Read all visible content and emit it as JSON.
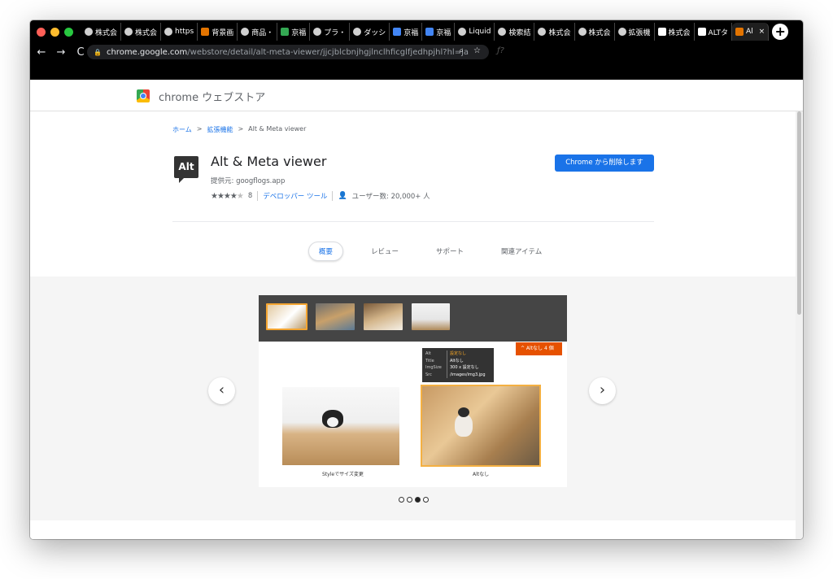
{
  "browser": {
    "tabs": [
      {
        "label": "株式会",
        "icon": "globe-icon"
      },
      {
        "label": "株式会",
        "icon": "globe-icon"
      },
      {
        "label": "https",
        "icon": "globe-icon"
      },
      {
        "label": "背景画",
        "icon": "image-icon"
      },
      {
        "label": "商品・",
        "icon": "globe-icon"
      },
      {
        "label": "京福",
        "icon": "sheets-icon"
      },
      {
        "label": "プラ・",
        "icon": "layers-icon"
      },
      {
        "label": "ダッシ",
        "icon": "globe-icon"
      },
      {
        "label": "京福",
        "icon": "docs-icon"
      },
      {
        "label": "京福",
        "icon": "docs-icon"
      },
      {
        "label": "Liquid",
        "icon": "drop-icon"
      },
      {
        "label": "検索結",
        "icon": "globe-icon"
      },
      {
        "label": "株式会",
        "icon": "globe-icon"
      },
      {
        "label": "株式会",
        "icon": "globe-icon"
      },
      {
        "label": "拡張機",
        "icon": "puzzle-icon"
      },
      {
        "label": "株式会",
        "icon": "hj-icon"
      },
      {
        "label": "ALTタ",
        "icon": "m-icon"
      },
      {
        "label": "Al",
        "icon": "image-icon",
        "active": true
      }
    ],
    "close_glyph": "×",
    "new_tab_glyph": "+",
    "url_host": "chrome.google.com",
    "url_path": "/webstore/detail/alt-meta-viewer/jjcjblcbnjhgjlnclhficglfjedhpjhl?hl=ja",
    "nav": {
      "back": "←",
      "forward": "→",
      "reload": "C"
    },
    "omni_icons": {
      "zoom": "⌕",
      "star": "☆"
    },
    "ext_glyph": "ƒ?"
  },
  "store": {
    "title": "chrome ウェブストア"
  },
  "breadcrumb": {
    "home": "ホーム",
    "sep": ">",
    "category": "拡張機能",
    "current": "Alt & Meta viewer"
  },
  "extension": {
    "logo_text": "Alt",
    "name": "Alt & Meta viewer",
    "provider": "提供元: googflogs.app",
    "rating_count": "8",
    "category": "デベロッパー ツール",
    "users": "ユーザー数: 20,000+ 人",
    "remove_button": "Chrome から削除します"
  },
  "nav_tabs": [
    {
      "label": "概要",
      "active": true
    },
    {
      "label": "レビュー"
    },
    {
      "label": "サポート"
    },
    {
      "label": "関連アイテム"
    }
  ],
  "gallery": {
    "popup": {
      "rows": [
        {
          "k": "Alt",
          "v": "設定なし",
          "warn": true
        },
        {
          "k": "Title",
          "v": "Altなし",
          "warn": false
        },
        {
          "k": "ImgSize",
          "v": "300 x 設定なし",
          "warn": false
        },
        {
          "k": "Src",
          "v": "/images/img3.jpg",
          "warn": false
        }
      ]
    },
    "alt_badge": "^ Altなし 4 個",
    "caption_left": "Styleでサイズ変更",
    "caption_right": "Altなし",
    "prev": "‹",
    "next": "›",
    "dots_total": 4,
    "dots_active_index": 2
  },
  "colors": {
    "accent": "#1a73e8",
    "highlight": "#f4a531",
    "badge": "#e65100"
  }
}
